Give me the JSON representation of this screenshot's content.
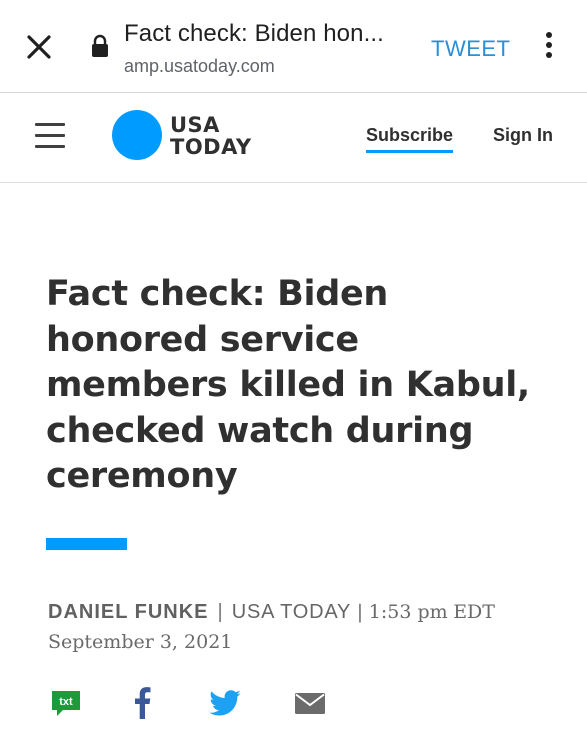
{
  "tab": {
    "title": "Fact check: Biden hon...",
    "url": "amp.usatoday.com",
    "tweet_label": "TWEET",
    "icons": [
      "close-icon",
      "lock-icon",
      "more-vert-icon"
    ]
  },
  "header": {
    "logo_line1": "USA",
    "logo_line2": "TODAY",
    "logo_color": "#009bff",
    "subscribe_label": "Subscribe",
    "signin_label": "Sign In",
    "icons": [
      "menu-icon"
    ]
  },
  "article": {
    "headline": "Fact check: Biden honored service members killed in Kabul, checked watch during ceremony",
    "author": "DANIEL FUNKE",
    "separator": "|",
    "publication": "USA TODAY",
    "time_separator": "|",
    "time": "1:53 pm",
    "date": "EDT September 3, 2021"
  },
  "share": {
    "icons": [
      "sms-icon",
      "facebook-icon",
      "twitter-icon",
      "email-icon"
    ],
    "sms_label": "txt"
  },
  "colors": {
    "accent": "#009bff",
    "tweet": "#2b8fd6",
    "sms_green": "#1f9a3a",
    "facebook": "#3b5998",
    "twitter": "#1da1f2",
    "mail": "#6b6b6b"
  }
}
